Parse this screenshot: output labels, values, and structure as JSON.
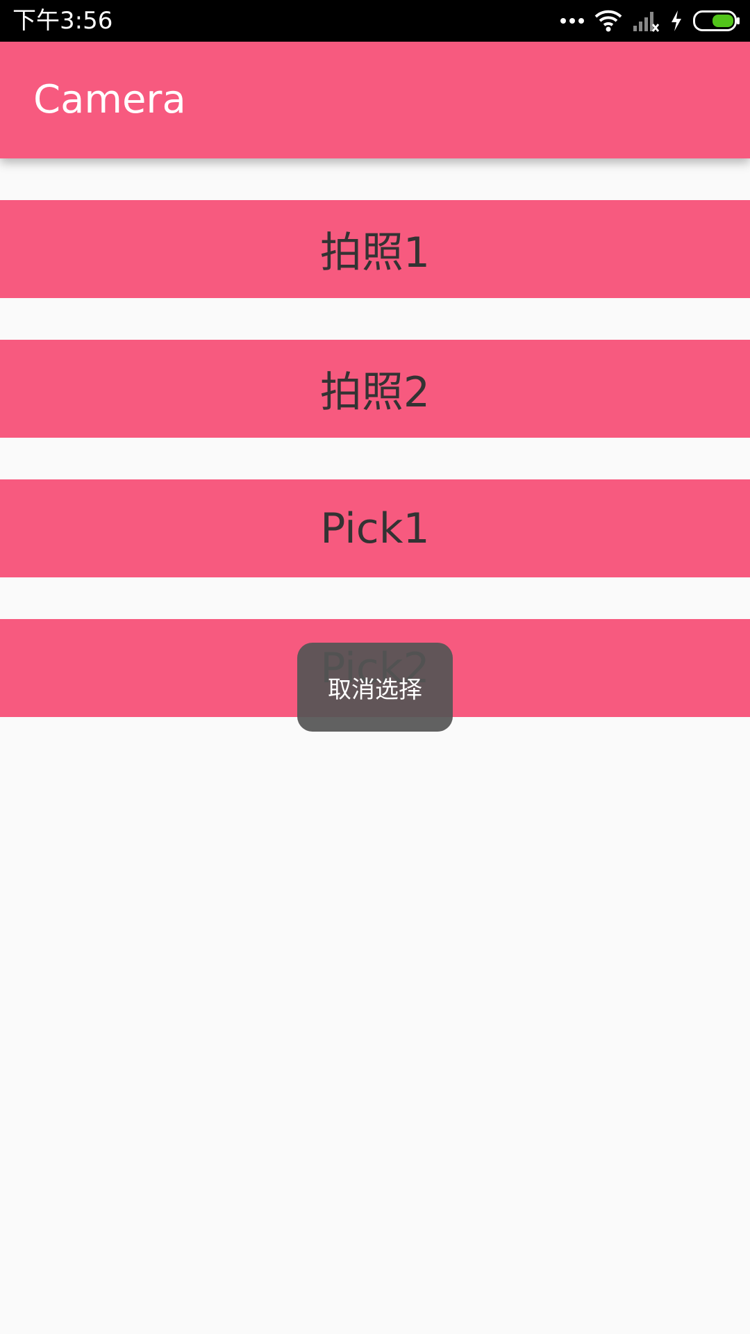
{
  "status_bar": {
    "time": "下午3:56",
    "icons": [
      "more-dots-icon",
      "wifi-icon",
      "signal-icon",
      "charging-icon",
      "battery-icon"
    ],
    "battery_color": "#52c41a"
  },
  "app_bar": {
    "title": "Camera",
    "background": "#f75a7f"
  },
  "buttons": [
    {
      "label": "拍照1"
    },
    {
      "label": "拍照2"
    },
    {
      "label": "Pick1"
    },
    {
      "label": "Pick2"
    }
  ],
  "toast": {
    "text": "取消选择"
  }
}
